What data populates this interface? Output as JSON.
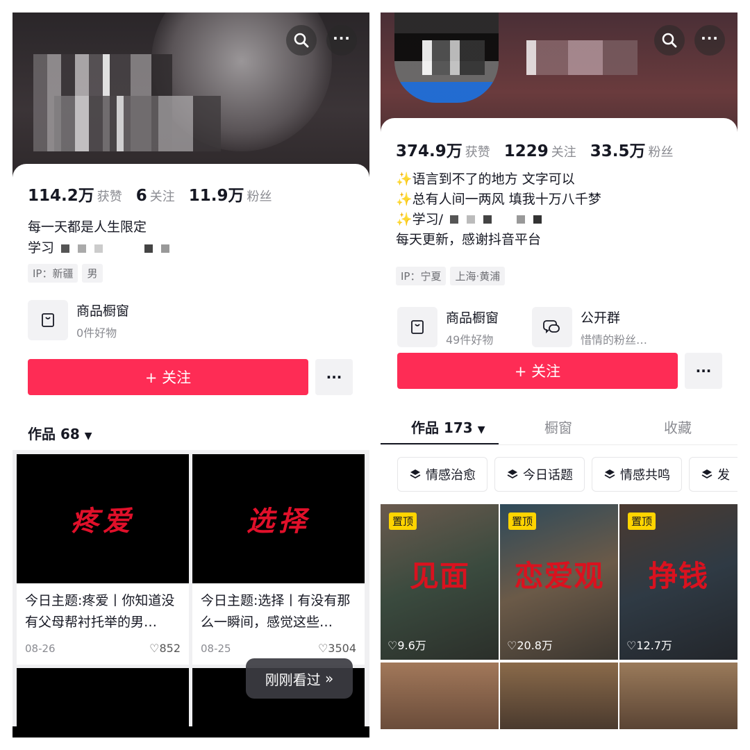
{
  "left": {
    "stats": [
      {
        "num": "114.2万",
        "label": "获赞"
      },
      {
        "num": "6",
        "label": "关注"
      },
      {
        "num": "11.9万",
        "label": "粉丝"
      }
    ],
    "bio": [
      "每一天都是人生限定",
      "学习"
    ],
    "tags": [
      "IP：新疆",
      "男"
    ],
    "shop": {
      "title": "商品橱窗",
      "sub": "0件好物"
    },
    "follow_label": "+ 关注",
    "more_label": "···",
    "works_tab": "作品 68",
    "videos": [
      {
        "cover": "疼爱",
        "desc": "今日主题:疼爱丨你知道没有父母帮衬托举的男…",
        "date": "08-26",
        "likes": "852"
      },
      {
        "cover": "选择",
        "desc": "今日主题:选择丨有没有那么一瞬间，感觉这些…",
        "date": "08-25",
        "likes": "3504"
      }
    ],
    "recent_label": "刚刚看过"
  },
  "right": {
    "stats": [
      {
        "num": "374.9万",
        "label": "获赞"
      },
      {
        "num": "1229",
        "label": "关注"
      },
      {
        "num": "33.5万",
        "label": "粉丝"
      }
    ],
    "bio": [
      "✨语言到不了的地方 文字可以",
      "✨总有人间一两风 填我十万八千梦",
      "✨学习/",
      "每天更新，感谢抖音平台"
    ],
    "tags": [
      "IP：宁夏",
      "上海·黄浦"
    ],
    "shop": {
      "title": "商品橱窗",
      "sub": "49件好物"
    },
    "group": {
      "title": "公开群",
      "sub": "惜情的粉丝…"
    },
    "follow_label": "+ 关注",
    "more_label": "···",
    "tabs": [
      "作品 173",
      "橱窗",
      "收藏"
    ],
    "chips": [
      "情感治愈",
      "今日话题",
      "情感共鸣",
      "发"
    ],
    "videos": [
      {
        "pin": "置顶",
        "cover": "见面",
        "likes": "9.6万"
      },
      {
        "pin": "置顶",
        "cover": "恋爱观",
        "likes": "20.8万"
      },
      {
        "pin": "置顶",
        "cover": "挣钱",
        "likes": "12.7万"
      }
    ]
  },
  "colors": {
    "accent": "#fe2c55",
    "pin": "#ffd400",
    "cover_text": "#d9121f"
  },
  "icons": [
    "search-icon",
    "more-icon",
    "shop-bag-icon",
    "group-chat-icon",
    "layers-icon",
    "heart-icon",
    "dropdown-triangle-icon",
    "chevron-down-double-icon"
  ]
}
